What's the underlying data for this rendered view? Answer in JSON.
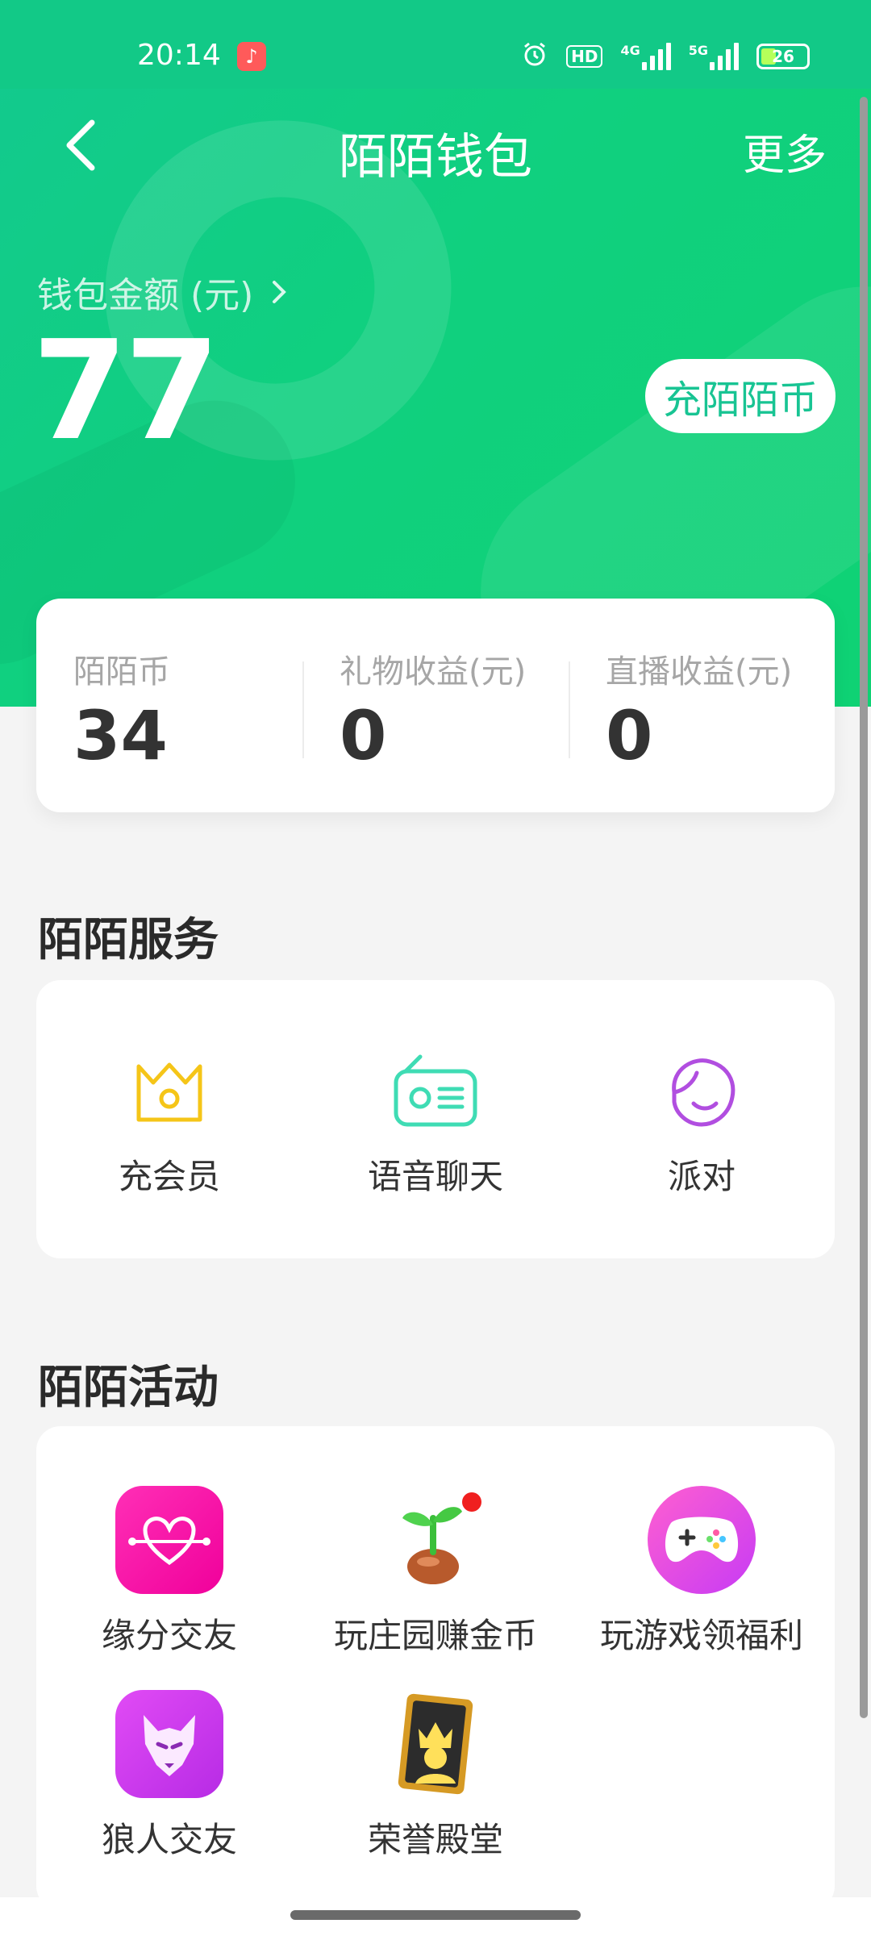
{
  "status_bar": {
    "time": "20:14",
    "battery": "26",
    "hd": "HD",
    "net1": "4G",
    "net2": "5G"
  },
  "nav": {
    "title": "陌陌钱包",
    "more": "更多"
  },
  "wallet": {
    "label": "钱包金额 (元)",
    "amount": "77",
    "recharge_button": "充陌陌币"
  },
  "stats": [
    {
      "label": "陌陌币",
      "value": "34"
    },
    {
      "label": "礼物收益(元)",
      "value": "0"
    },
    {
      "label": "直播收益(元)",
      "value": "0"
    }
  ],
  "services": {
    "title": "陌陌服务",
    "items": [
      {
        "label": "充会员",
        "icon": "crown-icon"
      },
      {
        "label": "语音聊天",
        "icon": "radio-icon"
      },
      {
        "label": "派对",
        "icon": "girl-face-icon"
      }
    ]
  },
  "activities": {
    "title": "陌陌活动",
    "items": [
      {
        "label": "缘分交友",
        "icon": "heart-link-icon"
      },
      {
        "label": "玩庄园赚金币",
        "icon": "sprout-icon"
      },
      {
        "label": "玩游戏领福利",
        "icon": "gamepad-icon"
      },
      {
        "label": "狼人交友",
        "icon": "wolf-icon"
      },
      {
        "label": "荣誉殿堂",
        "icon": "trophy-card-icon"
      }
    ]
  },
  "colors": {
    "brand_green": "#12c987",
    "accent_text": "#18c493"
  }
}
